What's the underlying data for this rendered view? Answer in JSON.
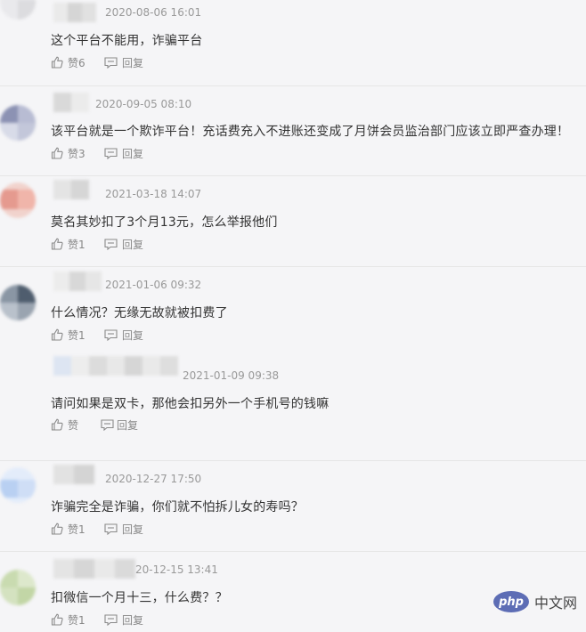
{
  "comments": [
    {
      "time": "2020-08-06 16:01",
      "text": "这个平台不能用，诈骗平台",
      "like_label": "赞6",
      "reply_label": "回复"
    },
    {
      "time": "2020-09-05 08:10",
      "text": "该平台就是一个欺诈平台！充话费充入不进账还变成了月饼会员监治部门应该立即严查办理！",
      "like_label": "赞3",
      "reply_label": "回复"
    },
    {
      "time": "2021-03-18 14:07",
      "text": "莫名其妙扣了3个月13元，怎么举报他们",
      "like_label": "赞1",
      "reply_label": "回复"
    },
    {
      "time": "2021-01-06 09:32",
      "text": "什么情况？无缘无故就被扣费了",
      "like_label": "赞1",
      "reply_label": "回复",
      "reply": {
        "time": "2021-01-09 09:38",
        "text": "请问如果是双卡，那他会扣另外一个手机号的钱嘛",
        "like_label": "赞",
        "reply_label": "回复"
      }
    },
    {
      "time": "2020-12-27 17:50",
      "text": "诈骗完全是诈骗，你们就不怕拆儿女的寿吗？",
      "like_label": "赞1",
      "reply_label": "回复"
    },
    {
      "time": "20-12-15 13:41",
      "text": "扣微信一个月十三，什么费？？",
      "like_label": "赞1",
      "reply_label": "回复"
    }
  ],
  "watermark": {
    "logo": "php",
    "text": "中文网"
  },
  "icons": {
    "like": "thumbs-up-icon",
    "reply": "speech-bubble-icon"
  }
}
